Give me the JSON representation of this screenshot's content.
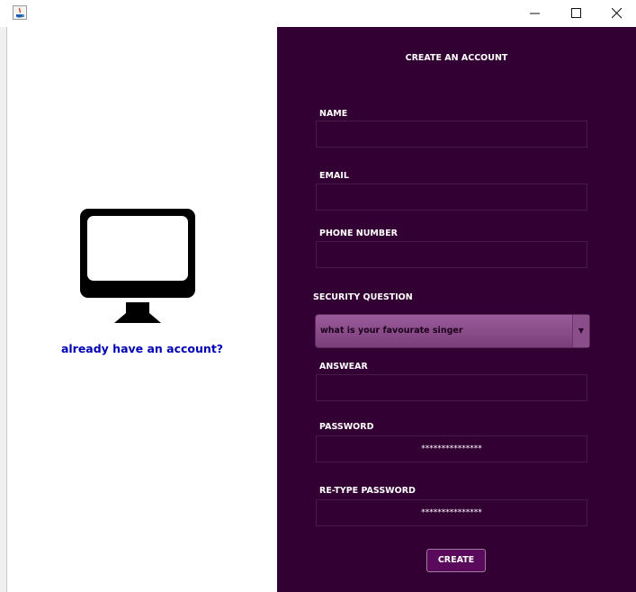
{
  "window": {
    "app_icon": "java-icon",
    "controls": [
      "minimize-icon",
      "maximize-icon",
      "close-icon"
    ]
  },
  "left": {
    "icon": "monitor-icon",
    "login_link": "already have an account?"
  },
  "form": {
    "title": "CREATE AN ACCOUNT",
    "name_label": "NAME",
    "email_label": "EMAIL",
    "phone_label": "PHONE NUMBER",
    "security_label": "SECURITY QUESTION",
    "security_selected": "what is your favourate singer",
    "answer_label": "ANSWEAR",
    "password_label": "PASSWORD",
    "password_value": "***************",
    "retype_label": "RE-TYPE PASSWORD",
    "retype_value": "***************",
    "create_label": "CREATE"
  },
  "colors": {
    "panel_bg": "#330033",
    "link": "#0000b4",
    "combo": "#8a4f8a"
  }
}
